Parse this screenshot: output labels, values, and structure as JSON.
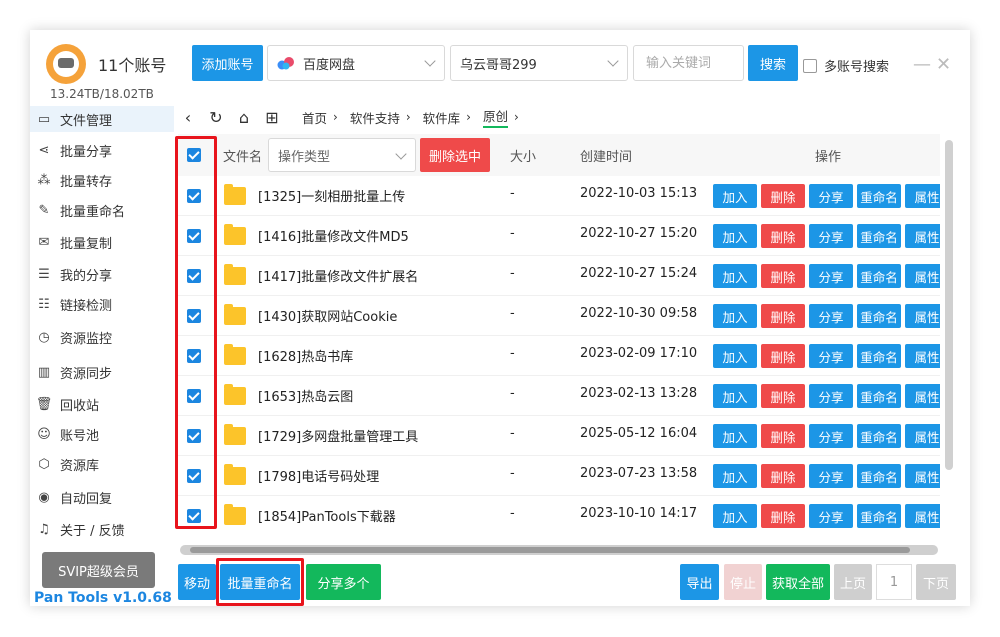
{
  "header": {
    "account_count": "11个账号",
    "storage": "13.24TB/18.02TB",
    "add_account": "添加账号",
    "drive_select": "百度网盘",
    "account_select": "乌云哥哥299",
    "keyword_placeholder": "输入关键词",
    "search": "搜索",
    "multi_search": "多账号搜索"
  },
  "sidebar": {
    "items": [
      {
        "label": "文件管理",
        "icon": "folder-icon"
      },
      {
        "label": "批量分享",
        "icon": "share-icon"
      },
      {
        "label": "批量转存",
        "icon": "transfer-icon"
      },
      {
        "label": "批量重命名",
        "icon": "rename-icon"
      },
      {
        "label": "批量复制",
        "icon": "copy-icon"
      },
      {
        "label": "我的分享",
        "icon": "my-share-icon"
      },
      {
        "label": "链接检测",
        "icon": "link-check-icon"
      },
      {
        "label": "资源监控",
        "icon": "monitor-icon"
      },
      {
        "label": "资源同步",
        "icon": "sync-icon"
      },
      {
        "label": "回收站",
        "icon": "trash-icon"
      },
      {
        "label": "账号池",
        "icon": "account-pool-icon"
      },
      {
        "label": "资源库",
        "icon": "library-icon"
      },
      {
        "label": "自动回复",
        "icon": "auto-reply-icon"
      },
      {
        "label": "关于 / 反馈",
        "icon": "bell-icon"
      }
    ],
    "svip": "SVIP超级会员",
    "version": "Pan Tools v1.0.68"
  },
  "breadcrumb": [
    "首页",
    "软件支持",
    "软件库",
    "原创"
  ],
  "table": {
    "col_name": "文件名",
    "operation_type": "操作类型",
    "delete_selected": "删除选中",
    "col_size": "大小",
    "col_created": "创建时间",
    "col_ops": "操作",
    "op_labels": [
      "加入",
      "删除",
      "分享",
      "重命名",
      "属性"
    ],
    "rows": [
      {
        "name": "[1325]一刻相册批量上传",
        "size": "-",
        "created": "2022-10-03 15:13"
      },
      {
        "name": "[1416]批量修改文件MD5",
        "size": "-",
        "created": "2022-10-27 15:20"
      },
      {
        "name": "[1417]批量修改文件扩展名",
        "size": "-",
        "created": "2022-10-27 15:24"
      },
      {
        "name": "[1430]获取网站Cookie",
        "size": "-",
        "created": "2022-10-30 09:58"
      },
      {
        "name": "[1628]热岛书库",
        "size": "-",
        "created": "2023-02-09 17:10"
      },
      {
        "name": "[1653]热岛云图",
        "size": "-",
        "created": "2023-02-13 13:28"
      },
      {
        "name": "[1729]多网盘批量管理工具",
        "size": "-",
        "created": "2025-05-12 16:04"
      },
      {
        "name": "[1798]电话号码处理",
        "size": "-",
        "created": "2023-07-23 13:58"
      },
      {
        "name": "[1854]PanTools下载器",
        "size": "-",
        "created": "2023-10-10 14:17"
      }
    ]
  },
  "footer": {
    "move": "移动",
    "batch_rename": "批量重命名",
    "share_multi": "分享多个",
    "export": "导出",
    "stop": "停止",
    "get_all": "获取全部",
    "prev": "上页",
    "page": "1",
    "next": "下页"
  },
  "colors": {
    "accent": "#1c96e6",
    "green": "#13b85c",
    "red": "#ef4a4a",
    "highlight": "#e8141c"
  }
}
